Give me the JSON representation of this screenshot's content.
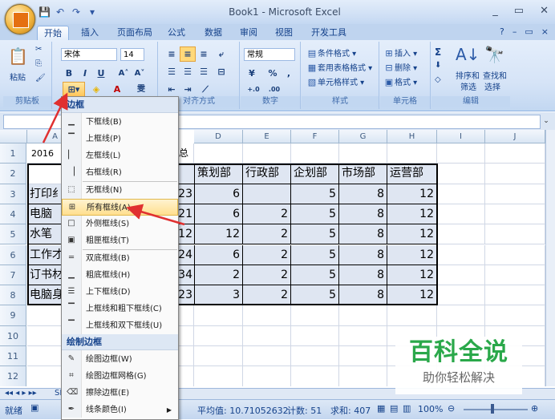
{
  "window": {
    "title": "Book1 - Microsoft Excel",
    "controls": [
      "_",
      "▭",
      "✕"
    ]
  },
  "quick_access": {
    "save": "💾",
    "undo": "↶",
    "redo": "↷",
    "more": "▾"
  },
  "tabs": [
    "开始",
    "插入",
    "页面布局",
    "公式",
    "数据",
    "审阅",
    "视图",
    "开发工具"
  ],
  "active_tab": "开始",
  "ribbon": {
    "clipboard": {
      "paste": "粘贴",
      "label": "剪贴板"
    },
    "font": {
      "name": "宋体",
      "size": "14",
      "bold": "B",
      "italic": "I",
      "underline": "U",
      "grow": "A˄",
      "shrink": "A˅",
      "wen": "雯"
    },
    "alignment": {
      "label": "对齐方式"
    },
    "number": {
      "format": "常规",
      "percent": "%",
      "comma": ",",
      "label": "数字",
      "inc": "+.0",
      "dec": ".00"
    },
    "styles": {
      "conditional": "条件格式",
      "table": "套用表格格式",
      "cell": "单元格样式",
      "label": "样式"
    },
    "cells": {
      "insert": "插入",
      "delete": "删除",
      "format": "格式",
      "label": "单元格"
    },
    "editing": {
      "sigma": "Σ",
      "sort": "排序和",
      "sort2": "筛选",
      "find": "查找和",
      "find2": "选择",
      "label": "编辑"
    }
  },
  "columns": [
    "A",
    "D",
    "E",
    "F",
    "G",
    "H",
    "I",
    "J"
  ],
  "rows": [
    "1",
    "2",
    "3",
    "4",
    "5",
    "6",
    "7",
    "8",
    "9",
    "10",
    "11",
    "12"
  ],
  "cells": {
    "a1": "2016",
    "c1_tail": "总",
    "headers": [
      "策划部",
      "行政部",
      "企划部",
      "市场部",
      "运营部"
    ],
    "a_col": [
      "打印纟",
      "电脑",
      "水笔",
      "工作才",
      "订书材",
      "电脑身"
    ],
    "c_col": [
      "23",
      "21",
      "12",
      "24",
      "34",
      "23"
    ],
    "data": [
      [
        "6",
        "",
        "5",
        "8",
        "12"
      ],
      [
        "6",
        "2",
        "5",
        "8",
        "12"
      ],
      [
        "12",
        "2",
        "5",
        "8",
        "12"
      ],
      [
        "6",
        "2",
        "5",
        "8",
        "12"
      ],
      [
        "2",
        "2",
        "5",
        "8",
        "12"
      ],
      [
        "3",
        "2",
        "5",
        "8",
        "12"
      ]
    ]
  },
  "dropdown": {
    "header1": "边框",
    "items1": [
      "下框线(B)",
      "上框线(P)",
      "左框线(L)",
      "右框线(R)"
    ],
    "items2": [
      "无框线(N)",
      "所有框线(A)",
      "外侧框线(S)",
      "粗匣框线(T)"
    ],
    "items3": [
      "双底框线(B)",
      "粗底框线(H)",
      "上下框线(D)",
      "上框线和粗下框线(C)",
      "上框线和双下框线(U)"
    ],
    "header2": "绘制边框",
    "items4": [
      "绘图边框(W)",
      "绘图边框网格(G)",
      "擦除边框(E)",
      "线条颜色(I)"
    ]
  },
  "sheet_tab": "SI",
  "status": {
    "ready": "就绪",
    "average": "平均值: 10.71052632",
    "count": "计数: 51",
    "sum": "求和: 407",
    "zoom": "100%"
  },
  "watermark": {
    "title": "百科全说",
    "subtitle": "助你轻松解决"
  },
  "colors": {
    "accent_red": "#e03030",
    "ribbon": "#d6e4f7",
    "hover": "#ffdf8f",
    "watermark": "#2aa84a"
  }
}
